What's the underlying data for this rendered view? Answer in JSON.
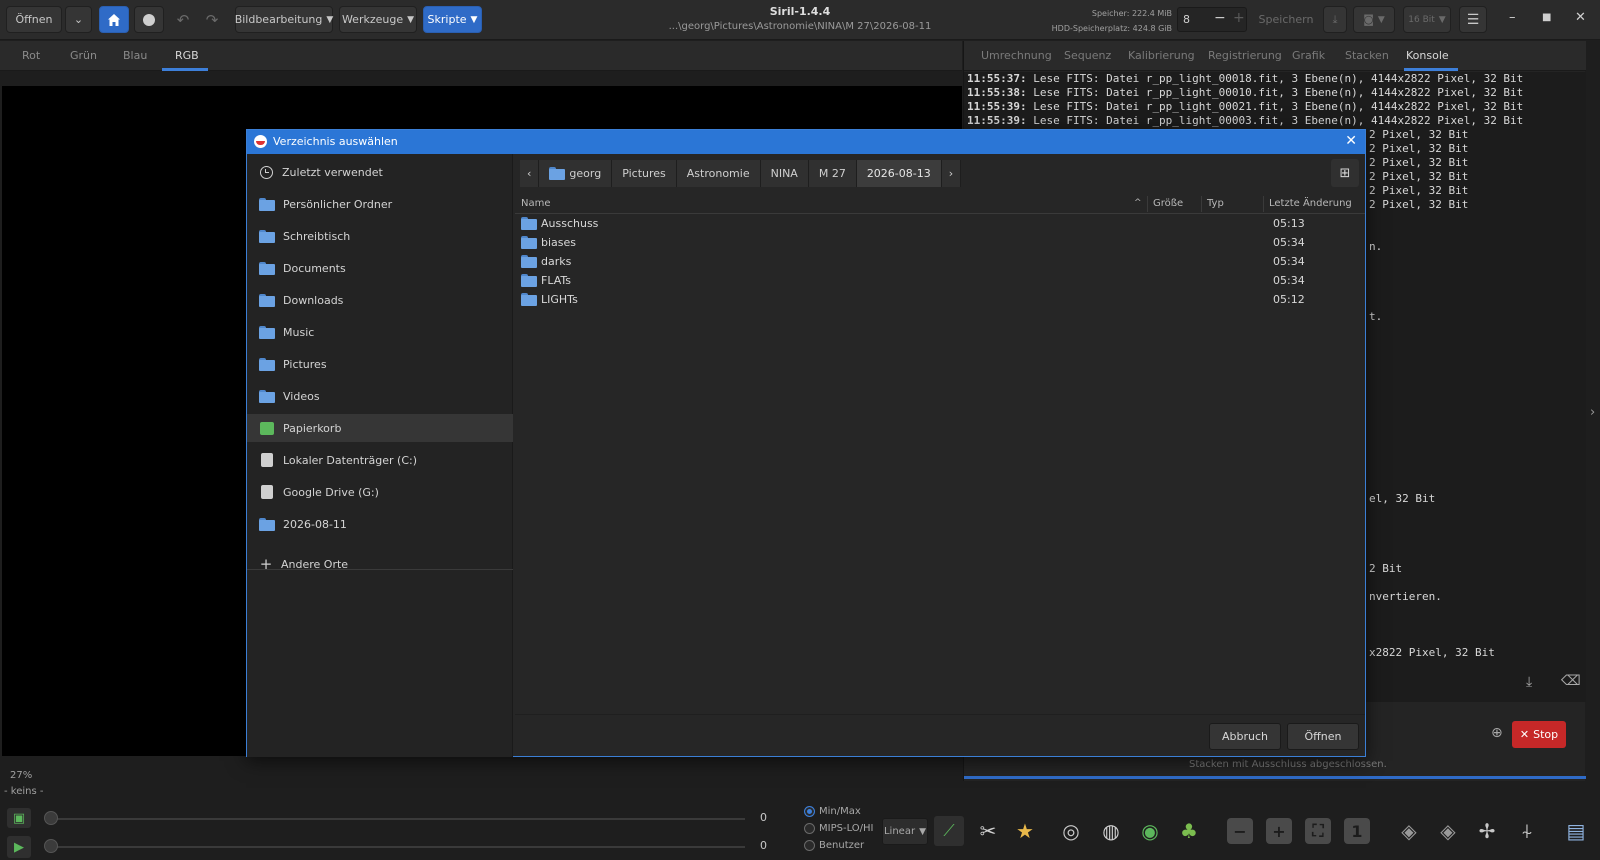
{
  "header": {
    "open_label": "Öffnen",
    "menus": [
      "Bildbearbeitung",
      "Werkzeuge",
      "Skripte"
    ],
    "app_title": "Siril-1.4.4",
    "path": "...\\georg\\Pictures\\Astronomie\\NINA\\M 27\\2026-08-11",
    "memory": "Speicher: 222.4 MiB",
    "disk": "HDD-Speicherplatz: 424.8 GiB",
    "cpu_value": "8",
    "save_label": "Speichern",
    "bitdepth": "16 Bit"
  },
  "channel_tabs": [
    "Rot",
    "Grün",
    "Blau",
    "RGB"
  ],
  "right_tabs": [
    "Umrechnung",
    "Sequenz",
    "Kalibrierung",
    "Registrierung",
    "Grafik",
    "Stacken",
    "Konsole"
  ],
  "console": {
    "lines": [
      {
        "time": "11:55:37:",
        "text": " Lese FITS: Datei r_pp_light_00018.fit, 3 Ebene(n), 4144x2822 Pixel, 32 Bit"
      },
      {
        "time": "11:55:38:",
        "text": " Lese FITS: Datei r_pp_light_00010.fit, 3 Ebene(n), 4144x2822 Pixel, 32 Bit"
      },
      {
        "time": "11:55:39:",
        "text": " Lese FITS: Datei r_pp_light_00021.fit, 3 Ebene(n), 4144x2822 Pixel, 32 Bit"
      },
      {
        "time": "11:55:39:",
        "text": " Lese FITS: Datei r_pp_light_00003.fit, 3 Ebene(n), 4144x2822 Pixel, 32 Bit"
      }
    ],
    "fragments": [
      "2 Pixel, 32 Bit",
      "2 Pixel, 32 Bit",
      "2 Pixel, 32 Bit",
      "2 Pixel, 32 Bit",
      "2 Pixel, 32 Bit",
      "2 Pixel, 32 Bit",
      "n.",
      "t.",
      "el, 32 Bit",
      "2 Bit",
      "nvertieren.",
      "x2822 Pixel, 32 Bit"
    ],
    "stop_label": "Stop",
    "status": "Stacken mit Ausschluss abgeschlossen."
  },
  "view": {
    "zoom": "27%",
    "sequence": "- keins -",
    "slider_hi": "0",
    "slider_lo": "0",
    "stretch_modes": [
      "Min/Max",
      "MIPS-LO/HI",
      "Benutzer"
    ],
    "selected_mode": "Min/Max",
    "scale": "Linear"
  },
  "dialog": {
    "title": "Verzeichnis auswählen",
    "sidebar": [
      {
        "label": "Zuletzt verwendet",
        "icon": "clock-icon"
      },
      {
        "label": "Persönlicher Ordner",
        "icon": "home-folder-icon"
      },
      {
        "label": "Schreibtisch",
        "icon": "desktop-folder-icon"
      },
      {
        "label": "Documents",
        "icon": "documents-folder-icon"
      },
      {
        "label": "Downloads",
        "icon": "downloads-folder-icon"
      },
      {
        "label": "Music",
        "icon": "music-folder-icon"
      },
      {
        "label": "Pictures",
        "icon": "pictures-folder-icon"
      },
      {
        "label": "Videos",
        "icon": "videos-folder-icon"
      },
      {
        "label": "Papierkorb",
        "icon": "trash-icon"
      },
      {
        "label": "Lokaler Datenträger (C:)",
        "icon": "drive-icon"
      },
      {
        "label": "Google Drive (G:)",
        "icon": "drive-icon"
      },
      {
        "label": "2026-08-11",
        "icon": "folder-icon"
      },
      {
        "label": "Andere Orte",
        "icon": "plus-icon"
      }
    ],
    "selected_sidebar": "Papierkorb",
    "breadcrumbs": [
      "georg",
      "Pictures",
      "Astronomie",
      "NINA",
      "M 27",
      "2026-08-13"
    ],
    "columns": {
      "name": "Name",
      "size": "Größe",
      "type": "Typ",
      "modified": "Letzte Änderung"
    },
    "files": [
      {
        "name": "Ausschuss",
        "modified": "05:13"
      },
      {
        "name": "biases",
        "modified": "05:34"
      },
      {
        "name": "darks",
        "modified": "05:34"
      },
      {
        "name": "FLATs",
        "modified": "05:34"
      },
      {
        "name": "LIGHTs",
        "modified": "05:12"
      }
    ],
    "cancel_label": "Abbruch",
    "open_label": "Öffnen"
  },
  "colors": {
    "accent": "#2b76d6",
    "stop": "#c62828",
    "folder": "#6ba2e3"
  }
}
